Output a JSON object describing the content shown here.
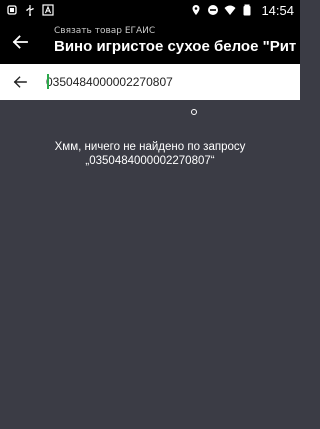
{
  "status_bar": {
    "time": "14:54",
    "left_icons": [
      "notification-icon",
      "usb-icon",
      "app-a-icon"
    ],
    "right_icons": [
      "location-icon",
      "do-not-disturb-icon",
      "wifi-icon",
      "battery-icon"
    ]
  },
  "app_bar": {
    "subtitle": "Связать товар ЕГАИС",
    "title": "Вино игристое сухое белое \"Рит"
  },
  "search": {
    "value": "0350484000002270807"
  },
  "empty_state": {
    "line1": "Хмм, ничего не найдено по запросу",
    "line2": "„0350484000002270807“"
  },
  "colors": {
    "background": "#3b3c45",
    "bars": "#000000",
    "caret": "#2aa84a"
  }
}
